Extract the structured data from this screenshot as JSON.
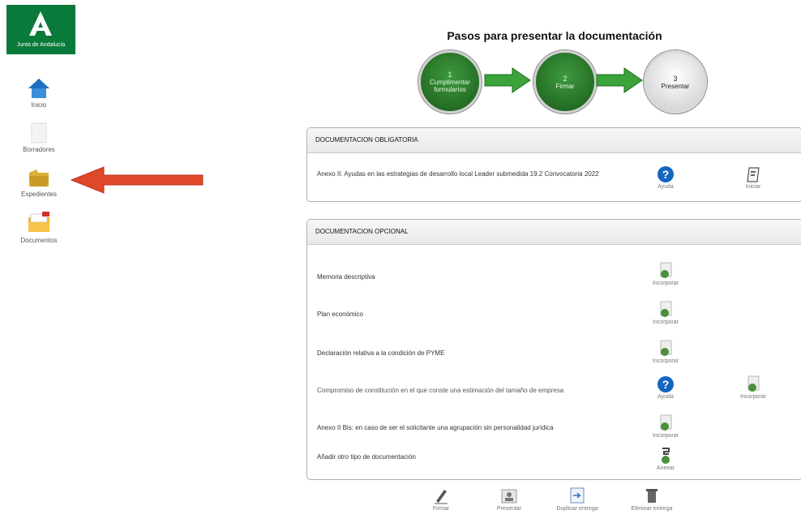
{
  "sidebar": {
    "logo_text": "Junta de Andalucía",
    "items": [
      {
        "label": "Inicio",
        "icon": "home-icon"
      },
      {
        "label": "Borradores",
        "icon": "draft-icon"
      },
      {
        "label": "Expedientes",
        "icon": "folder-icon"
      },
      {
        "label": "Documentos",
        "icon": "documents-icon"
      }
    ]
  },
  "header": {
    "title": "Pasos para presentar la documentación",
    "steps": [
      {
        "num": "1",
        "label": "Cumplimentar formularios"
      },
      {
        "num": "2",
        "label": "Firmar"
      },
      {
        "num": "3",
        "label": "Presentar"
      }
    ]
  },
  "mandatory": {
    "heading": "DOCUMENTACION OBLIGATORIA",
    "rows": [
      {
        "text": "Anexo II. Ayudas en las estrategias de desarrollo local Leader submedida 19.2 Convocatoria 2022",
        "help_label": "Ayuda",
        "action_label": "Iniciar"
      }
    ]
  },
  "optional": {
    "heading": "DOCUMENTACION OPCIONAL",
    "rows": [
      {
        "text": "Memoria descriptiva",
        "action_label": "Incorporar"
      },
      {
        "text": "Plan económico",
        "action_label": "Incorporar"
      },
      {
        "text": "Declaración relativa a la condición de PYME",
        "action_label": "Incorporar"
      },
      {
        "text": "Compromiso de constitución en el que conste una estimación del tamaño de empresa",
        "help_label": "Ayuda",
        "action_label": "Incorporar"
      },
      {
        "text": "Anexo II Bis: en caso de ser el solicitante una agrupación sin personalidad jurídica",
        "action_label": "Incorporar"
      },
      {
        "text": "Añadir otro tipo de documentación",
        "action_label": "Anexar"
      }
    ]
  },
  "toolbar": {
    "sign_label": "Firmar",
    "submit_label": "Presentar",
    "duplicate_label": "Duplicar entrega",
    "delete_label": "Eliminar entrega"
  },
  "colors": {
    "brand_green": "#0a7a3a",
    "step_green": "#2f7d2f",
    "arrow_red": "#e0482a",
    "help_blue": "#1565c0"
  }
}
